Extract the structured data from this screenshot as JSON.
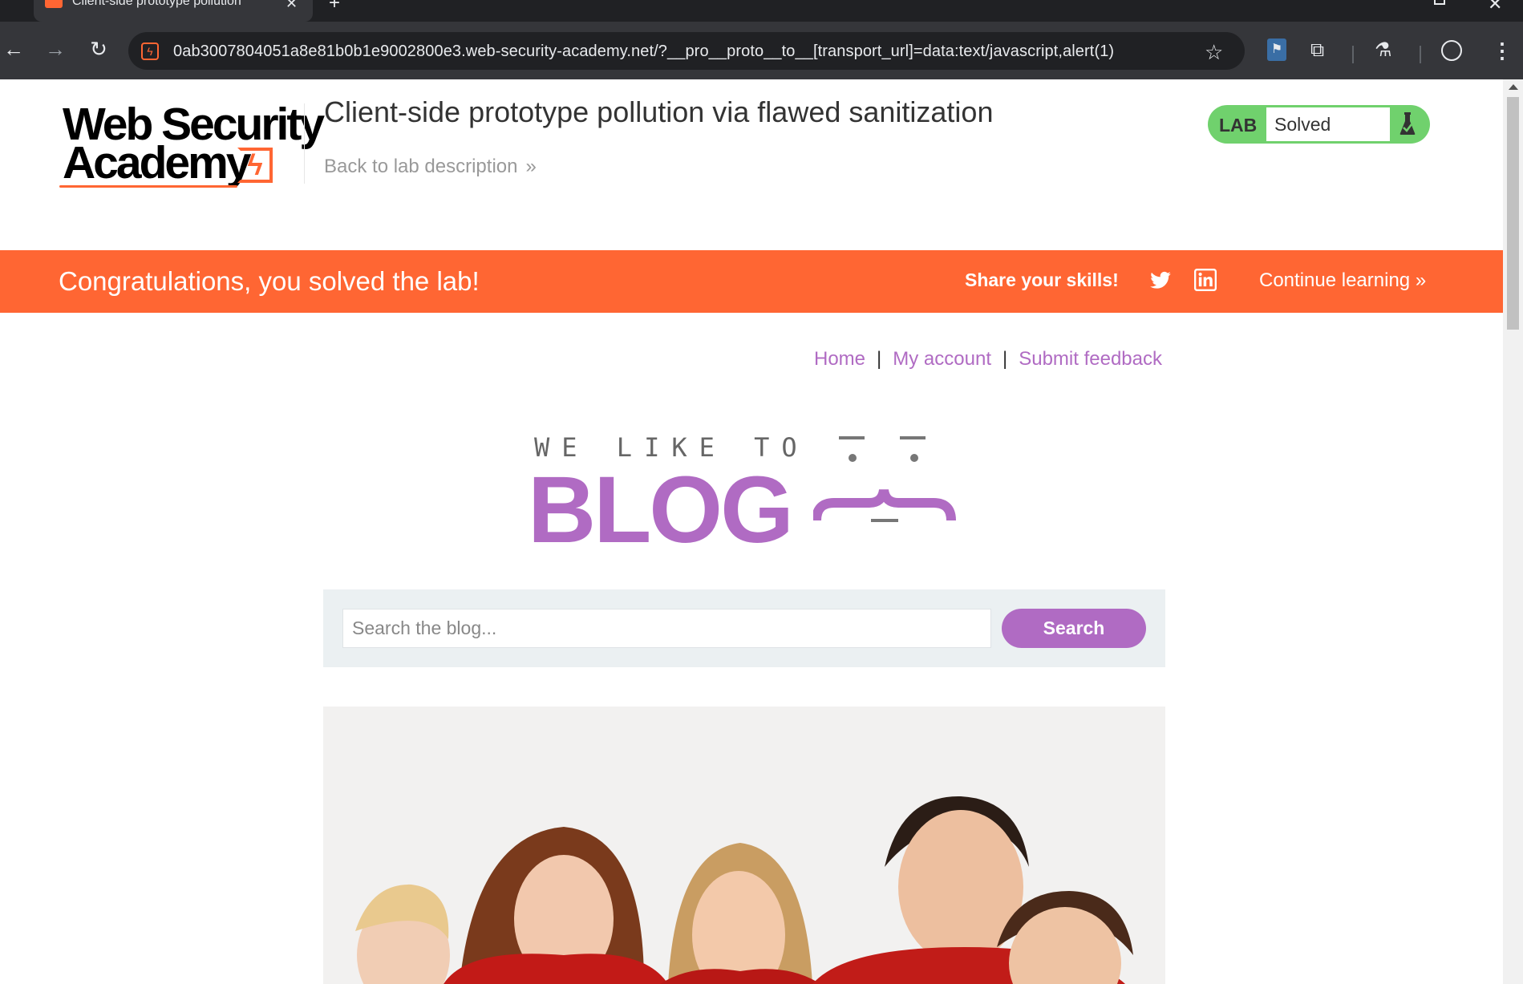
{
  "browser": {
    "tab_title": "Client-side prototype pollution",
    "url": "0ab3007804051a8e81b0b1e9002800e3.web-security-academy.net/?__pro__proto__to__[transport_url]=data:text/javascript,alert(1)"
  },
  "header": {
    "logo_line1": "Web Security",
    "logo_line2": "Academy",
    "lab_title": "Client-side prototype pollution via flawed sanitization",
    "back_link": "Back to lab description",
    "back_chevron": "»"
  },
  "lab_status": {
    "label": "LAB",
    "value": "Solved",
    "color": "#70d16d"
  },
  "banner": {
    "message": "Congratulations, you solved the lab!",
    "share_label": "Share your skills!",
    "continue_label": "Continue learning",
    "continue_chevron": "»",
    "color": "#ff6633"
  },
  "nav": {
    "home": "Home",
    "my_account": "My account",
    "submit_feedback": "Submit feedback",
    "separator": "|"
  },
  "blog": {
    "tagline": "WE LIKE TO",
    "title": "BLOG",
    "accent_color": "#b06bc3"
  },
  "search": {
    "placeholder": "Search the blog...",
    "value": "",
    "button_label": "Search"
  },
  "icons": {
    "back": "arrow-left-icon",
    "forward": "arrow-right-icon",
    "reload": "reload-icon",
    "bookmark": "star-icon",
    "extensions": "puzzle-icon",
    "labs": "flask-icon",
    "profile": "profile-icon",
    "menu": "kebab-menu-icon",
    "share_twitter": "twitter-icon",
    "share_linkedin": "linkedin-icon"
  }
}
